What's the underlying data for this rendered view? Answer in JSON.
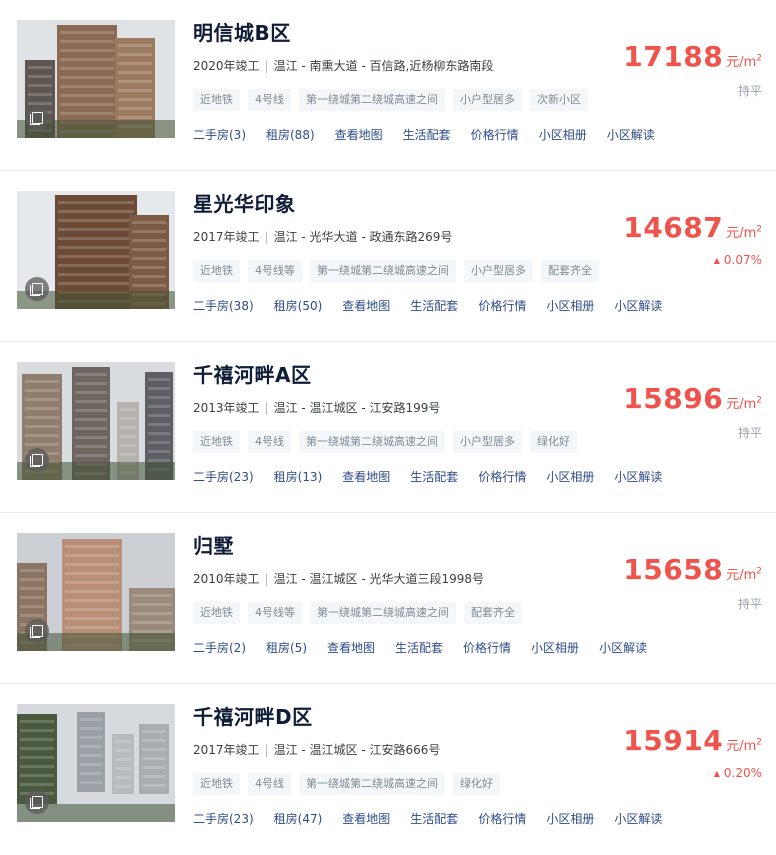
{
  "accent_color": "#f0534b",
  "link_color": "#2d4c8a",
  "price_unit": "元/m",
  "price_unit_sup": "2",
  "listings": [
    {
      "name": "明信城B区",
      "year": "2020年竣工",
      "location": "温江 - 南熏大道 - 百信路,近杨柳东路南段",
      "tags": [
        "近地铁",
        "4号线",
        "第一绕城第二绕城高速之间",
        "小户型居多",
        "次新小区"
      ],
      "links": [
        "二手房(3)",
        "租房(88)",
        "查看地图",
        "生活配套",
        "价格行情",
        "小区相册",
        "小区解读"
      ],
      "price": "17188",
      "trend": "持平",
      "trend_dir": "flat",
      "photo_icon": "album-icon"
    },
    {
      "name": "星光华印象",
      "year": "2017年竣工",
      "location": "温江 - 光华大道 - 政通东路269号",
      "tags": [
        "近地铁",
        "4号线等",
        "第一绕城第二绕城高速之间",
        "小户型居多",
        "配套齐全"
      ],
      "links": [
        "二手房(38)",
        "租房(50)",
        "查看地图",
        "生活配套",
        "价格行情",
        "小区相册",
        "小区解读"
      ],
      "price": "14687",
      "trend": "0.07%",
      "trend_dir": "up",
      "photo_icon": "album-icon"
    },
    {
      "name": "千禧河畔A区",
      "year": "2013年竣工",
      "location": "温江 - 温江城区 - 江安路199号",
      "tags": [
        "近地铁",
        "4号线",
        "第一绕城第二绕城高速之间",
        "小户型居多",
        "绿化好"
      ],
      "links": [
        "二手房(23)",
        "租房(13)",
        "查看地图",
        "生活配套",
        "价格行情",
        "小区相册",
        "小区解读"
      ],
      "price": "15896",
      "trend": "持平",
      "trend_dir": "flat",
      "photo_icon": "album-icon"
    },
    {
      "name": "归墅",
      "year": "2010年竣工",
      "location": "温江 - 温江城区 - 光华大道三段1998号",
      "tags": [
        "近地铁",
        "4号线等",
        "第一绕城第二绕城高速之间",
        "配套齐全"
      ],
      "links": [
        "二手房(2)",
        "租房(5)",
        "查看地图",
        "生活配套",
        "价格行情",
        "小区相册",
        "小区解读"
      ],
      "price": "15658",
      "trend": "持平",
      "trend_dir": "flat",
      "photo_icon": "album-icon"
    },
    {
      "name": "千禧河畔D区",
      "year": "2017年竣工",
      "location": "温江 - 温江城区 - 江安路666号",
      "tags": [
        "近地铁",
        "4号线",
        "第一绕城第二绕城高速之间",
        "绿化好"
      ],
      "links": [
        "二手房(23)",
        "租房(47)",
        "查看地图",
        "生活配套",
        "价格行情",
        "小区相册",
        "小区解读"
      ],
      "price": "15914",
      "trend": "0.20%",
      "trend_dir": "up",
      "photo_icon": "album-icon"
    }
  ]
}
